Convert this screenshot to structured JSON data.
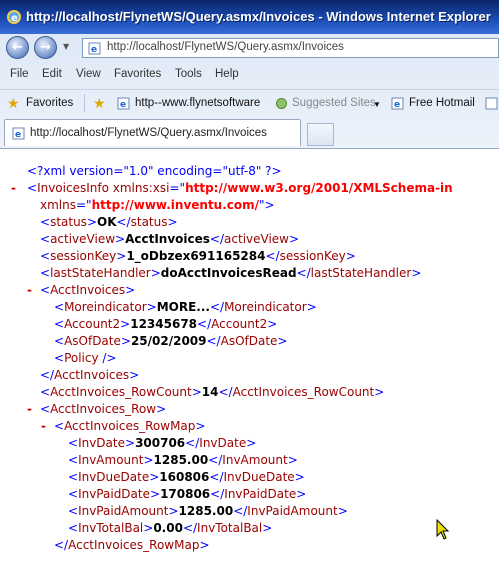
{
  "window": {
    "title": "http://localhost/FlynetWS/Query.asmx/Invoices - Windows Internet Explorer"
  },
  "address_bar": {
    "url": "http://localhost/FlynetWS/Query.asmx/Invoices"
  },
  "menu": [
    "File",
    "Edit",
    "View",
    "Favorites",
    "Tools",
    "Help"
  ],
  "favorites_bar": {
    "favorites_label": "Favorites",
    "items": [
      "http--www.flynetsoftware",
      "Suggested Sites",
      "Free Hotmail"
    ]
  },
  "tab": {
    "label": "http://localhost/FlynetWS/Query.asmx/Invoices"
  },
  "xml": {
    "declaration": "<?xml version=\"1.0\" encoding=\"utf-8\" ?>",
    "root_tag": "InvoicesInfo",
    "xsi_attr": "xmlns:xsi",
    "xsi_value": "http://www.w3.org/2001/XMLSchema-in",
    "xmlns_attr": "xmlns",
    "xmlns_value": "http://www.inventu.com/",
    "status": {
      "tag": "status",
      "value": "OK"
    },
    "activeView": {
      "tag": "activeView",
      "value": "AcctInvoices"
    },
    "sessionKey": {
      "tag": "sessionKey",
      "value": "1_oDbzex691165284"
    },
    "lastStateHandler": {
      "tag": "lastStateHandler",
      "value": "doAcctInvoicesRead"
    },
    "acctInvoices_tag": "AcctInvoices",
    "moreindicator": {
      "tag": "Moreindicator",
      "value": "MORE..."
    },
    "account2": {
      "tag": "Account2",
      "value": "12345678"
    },
    "asOfDate": {
      "tag": "AsOfDate",
      "value": "25/02/2009"
    },
    "policy_tag": "Policy",
    "rowCount": {
      "tag": "AcctInvoices_RowCount",
      "value": "14"
    },
    "row_tag": "AcctInvoices_Row",
    "rowmap_tag": "AcctInvoices_RowMap",
    "invDate": {
      "tag": "InvDate",
      "value": "300706"
    },
    "invAmount": {
      "tag": "InvAmount",
      "value": "1285.00"
    },
    "invDueDate": {
      "tag": "InvDueDate",
      "value": "160806"
    },
    "invPaidDate": {
      "tag": "InvPaidDate",
      "value": "170806"
    },
    "invPaidAmount": {
      "tag": "InvPaidAmount",
      "value": "1285.00"
    },
    "invTotalBal": {
      "tag": "InvTotalBal",
      "value": "0.00"
    }
  }
}
